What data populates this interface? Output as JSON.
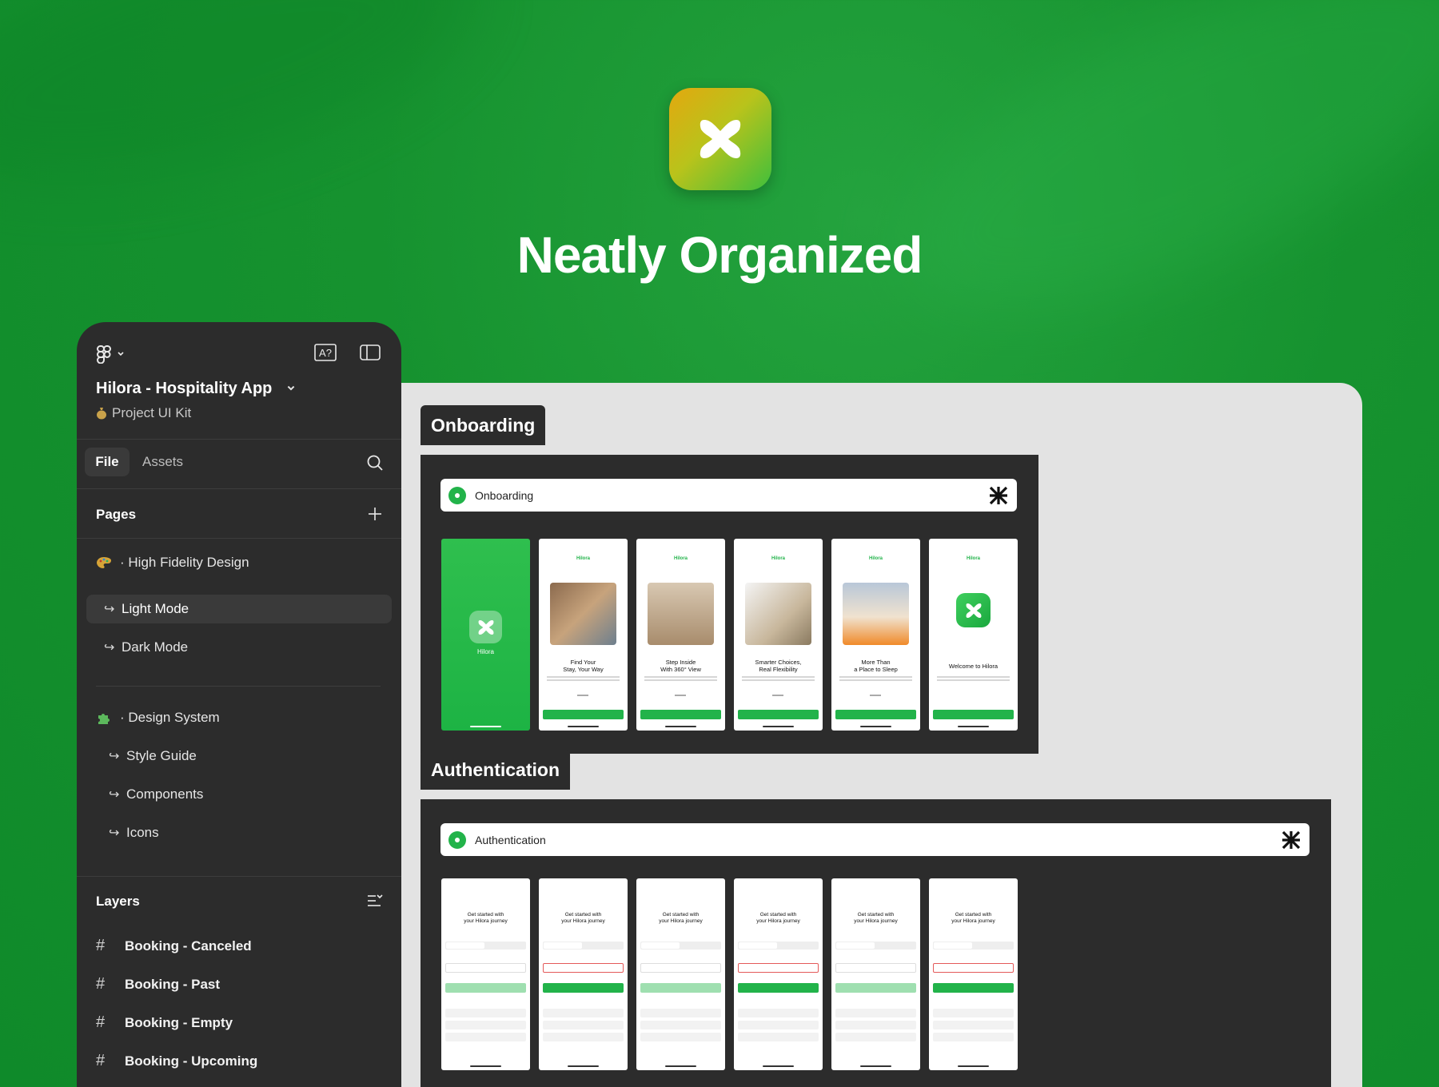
{
  "hero": {
    "title": "Neatly Organized"
  },
  "sidebar": {
    "project_title": "Hilora - Hospitality App",
    "project_subtitle": "Project UI Kit",
    "tabs": {
      "file": "File",
      "assets": "Assets"
    },
    "pages_heading": "Pages",
    "pages": [
      {
        "label": "· High Fidelity Design"
      },
      {
        "label": "Light Mode"
      },
      {
        "label": "Dark Mode"
      },
      {
        "label": "· Design System"
      },
      {
        "label": "Style Guide"
      },
      {
        "label": "Components"
      },
      {
        "label": "Icons"
      }
    ],
    "layers_heading": "Layers",
    "layers": [
      {
        "label": "Booking - Canceled"
      },
      {
        "label": "Booking - Past"
      },
      {
        "label": "Booking - Empty"
      },
      {
        "label": "Booking - Upcoming"
      }
    ]
  },
  "canvas": {
    "onboarding": {
      "section_label": "Onboarding",
      "header_label": "Onboarding",
      "splash_name": "Hilora",
      "brand": "Hilora",
      "screens": [
        {
          "title": "Find Your\nStay, Your Way"
        },
        {
          "title": "Step Inside\nWith 360° View"
        },
        {
          "title": "Smarter Choices,\nReal Flexibility"
        },
        {
          "title": "More Than\na Place to Sleep"
        },
        {
          "title": "Welcome to Hilora"
        }
      ]
    },
    "authentication": {
      "section_label": "Authentication",
      "header_label": "Authentication",
      "screen_title": "Get started with\nyour Hilora journey"
    }
  },
  "colors": {
    "accent": "#22b34a",
    "panel": "#2c2c2c",
    "canvas": "#e3e3e3"
  }
}
